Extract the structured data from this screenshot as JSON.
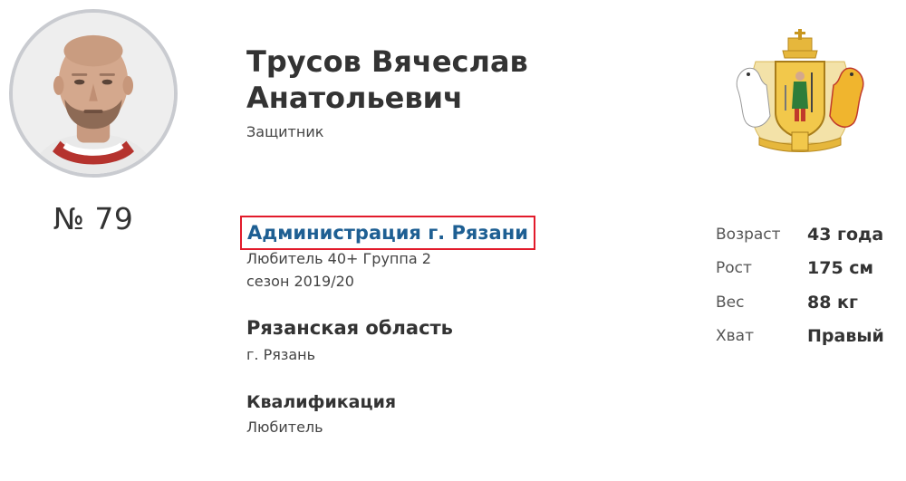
{
  "player": {
    "number": "№ 79",
    "name_line1": "Трусов Вячеслав",
    "name_line2": "Анатольевич",
    "position": "Защитник"
  },
  "team": {
    "name": "Администрация г. Рязани",
    "league": "Любитель 40+ Группа 2",
    "season": "сезон 2019/20"
  },
  "region": {
    "title": "Рязанская область",
    "city": "г. Рязань"
  },
  "qualification": {
    "title": "Квалификация",
    "value": "Любитель"
  },
  "stats": [
    {
      "label": "Возраст",
      "value": "43 года"
    },
    {
      "label": "Рост",
      "value": "175 см"
    },
    {
      "label": "Вес",
      "value": "88 кг"
    },
    {
      "label": "Хват",
      "value": "Правый"
    }
  ],
  "colors": {
    "link": "#1e5f93",
    "highlight_border": "#e21b2b",
    "avatar_border": "#c9cbd0"
  },
  "icons": {
    "avatar": "player-photo",
    "emblem": "ryazan-coat-of-arms"
  }
}
